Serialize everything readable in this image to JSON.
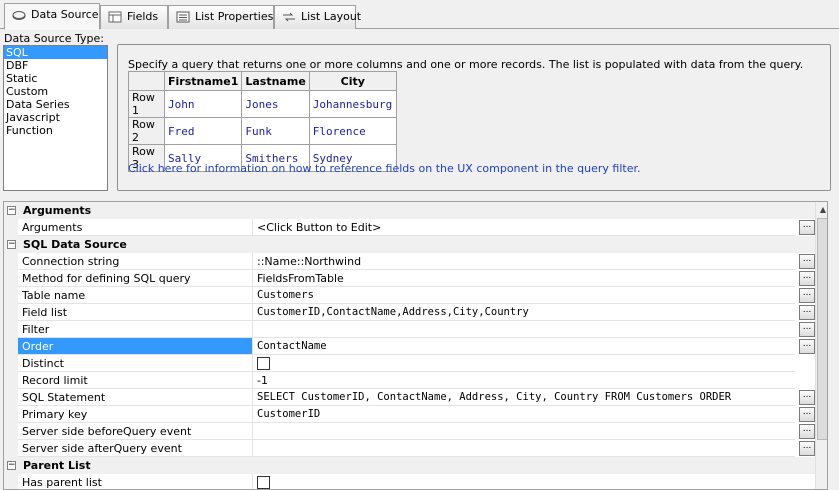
{
  "tabs": [
    {
      "label": "Data Source",
      "icon": "database-icon"
    },
    {
      "label": "Fields",
      "icon": "fields-icon"
    },
    {
      "label": "List Properties",
      "icon": "list-properties-icon"
    },
    {
      "label": "List Layout",
      "icon": "list-layout-icon"
    }
  ],
  "datasource": {
    "label": "Data Source Type:",
    "items": [
      "SQL",
      "DBF",
      "Static",
      "Custom",
      "Data Series",
      "Javascript Function"
    ],
    "selected": "SQL"
  },
  "info": {
    "description": "Specify a query that returns one or more columns and one or more records. The list is populated with data from the query.",
    "columns": [
      "Firstname1",
      "Lastname",
      "City"
    ],
    "rows": [
      {
        "label": "Row 1",
        "cells": [
          "John",
          "Jones",
          "Johannesburg"
        ]
      },
      {
        "label": "Row 2",
        "cells": [
          "Fred",
          "Funk",
          "Florence"
        ]
      },
      {
        "label": "Row 3",
        "cells": [
          "Sally",
          "Smithers",
          "Sydney"
        ]
      }
    ],
    "link": "Click here for information on how to reference fields on the UX component in the query filter."
  },
  "grid": {
    "categories": {
      "arguments": "Arguments",
      "sql": "SQL Data Source",
      "parent": "Parent List"
    },
    "collapse_glyph": "−",
    "ellipsis": "...",
    "properties": {
      "arguments": {
        "name": "Arguments",
        "value": "<Click Button to Edit>"
      },
      "connection": {
        "name": "Connection string",
        "value": "::Name::Northwind"
      },
      "method": {
        "name": "Method for defining SQL query",
        "value": "FieldsFromTable"
      },
      "table": {
        "name": "Table name",
        "value": "Customers"
      },
      "fieldlist": {
        "name": "Field list",
        "value": "CustomerID,ContactName,Address,City,Country"
      },
      "filter": {
        "name": "Filter",
        "value": ""
      },
      "order": {
        "name": "Order",
        "value": "ContactName"
      },
      "distinct": {
        "name": "Distinct",
        "checked": false
      },
      "recordlimit": {
        "name": "Record limit",
        "value": "-1"
      },
      "sqlstatement": {
        "name": "SQL Statement",
        "value": "SELECT CustomerID, ContactName, Address, City, Country FROM Customers   ORDER"
      },
      "primarykey": {
        "name": "Primary key",
        "value": "CustomerID"
      },
      "beforequery": {
        "name": "Server side beforeQuery event",
        "value": ""
      },
      "afterquery": {
        "name": "Server side afterQuery event",
        "value": ""
      },
      "hasparent": {
        "name": "Has parent list",
        "checked": false
      }
    },
    "selected": "Order"
  }
}
